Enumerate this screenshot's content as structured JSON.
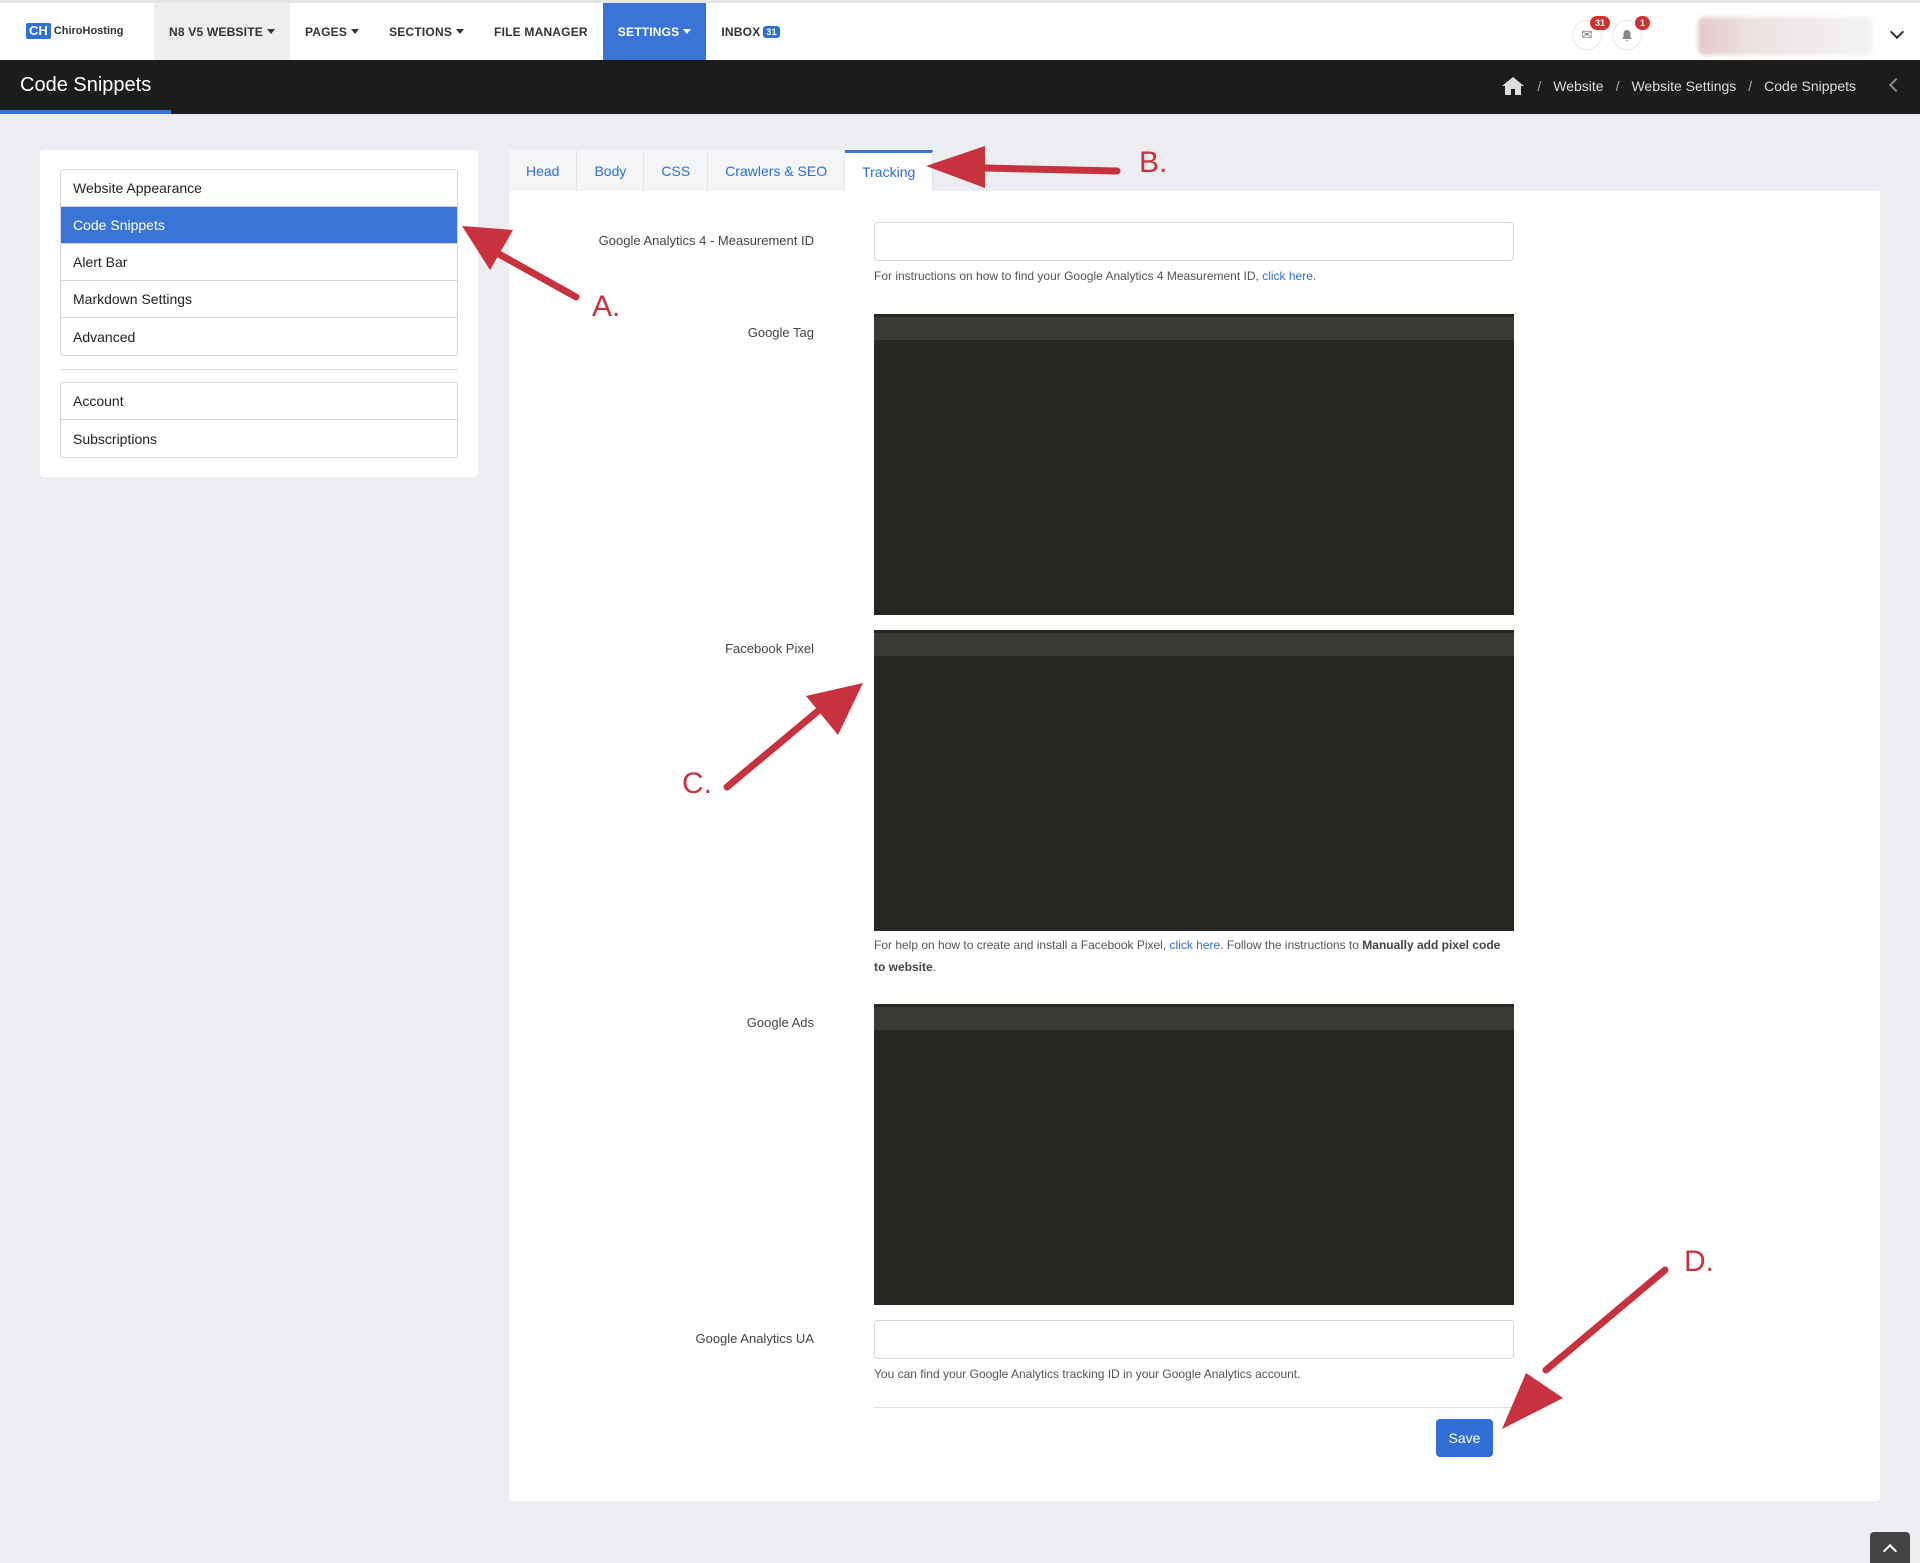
{
  "brand": {
    "mark": "CH",
    "name": "ChiroHosting"
  },
  "nav": {
    "items": [
      {
        "label": "N8 V5 WEBSITE",
        "dropdown": true
      },
      {
        "label": "PAGES",
        "dropdown": true
      },
      {
        "label": "SECTIONS",
        "dropdown": true
      },
      {
        "label": "FILE MANAGER",
        "dropdown": false
      },
      {
        "label": "SETTINGS",
        "dropdown": true
      },
      {
        "label": "INBOX",
        "dropdown": false
      }
    ],
    "inbox_badge": "31",
    "mail_count": "31",
    "notif_count": "1"
  },
  "header": {
    "title": "Code Snippets",
    "breadcrumbs": [
      "Website",
      "Website Settings",
      "Code Snippets"
    ]
  },
  "sidebar": {
    "group1": [
      "Website Appearance",
      "Code Snippets",
      "Alert Bar",
      "Markdown Settings",
      "Advanced"
    ],
    "group2": [
      "Account",
      "Subscriptions"
    ],
    "selected": "Code Snippets"
  },
  "tabs": [
    "Head",
    "Body",
    "CSS",
    "Crawlers & SEO",
    "Tracking"
  ],
  "active_tab": "Tracking",
  "form": {
    "ga4": {
      "label": "Google Analytics 4 - Measurement ID",
      "value": "",
      "help": "For instructions on how to find your Google Analytics 4 Measurement ID,",
      "link": "click here",
      "help_end": "."
    },
    "google_tag": {
      "label": "Google Tag"
    },
    "facebook_pixel": {
      "label": "Facebook Pixel",
      "help_start": "For help on how to create and install a Facebook Pixel,",
      "link": "click here",
      "help_mid": ". Follow the instructions to",
      "help_bold": "Manually add pixel code to website",
      "help_end": "."
    },
    "google_ads": {
      "label": "Google Ads"
    },
    "ga_ua": {
      "label": "Google Analytics UA",
      "value": "",
      "help": "You can find your Google Analytics tracking ID in your Google Analytics account."
    },
    "save_label": "Save"
  },
  "annotations": [
    "A.",
    "B.",
    "C.",
    "D."
  ],
  "colors": {
    "accent": "#3a74d6",
    "annotation": "#c8313e",
    "editor_bg": "#272822",
    "titlebar": "#1c1c1c"
  }
}
